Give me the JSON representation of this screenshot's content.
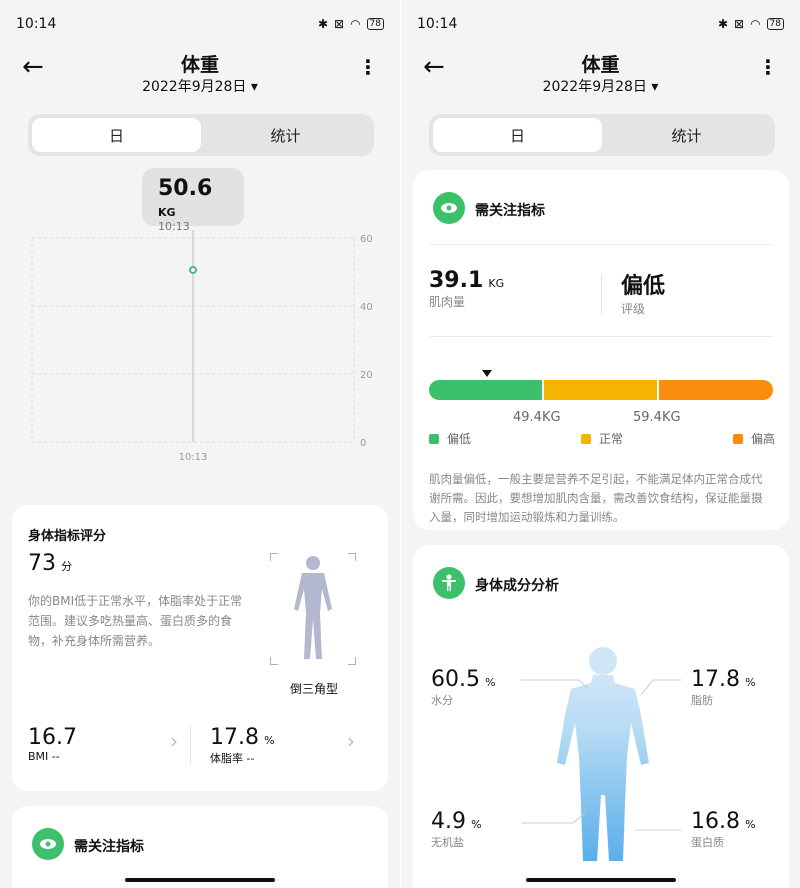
{
  "left": {
    "status": {
      "time": "10:14",
      "battery": "78"
    },
    "header": {
      "title": "体重",
      "date": "2022年9月28日",
      "date_caret": "▾"
    },
    "tabs": [
      "日",
      "统计"
    ],
    "tooltip": {
      "value": "50.6",
      "unit": "KG",
      "time": "10:13"
    },
    "chart_data": {
      "type": "scatter",
      "x": [
        "10:13"
      ],
      "y": [
        50.6
      ],
      "ylim": [
        0,
        60
      ],
      "yticks": [
        "60",
        "40",
        "20",
        "0"
      ],
      "xticks": [
        "10:13"
      ],
      "grid": true
    },
    "score_card": {
      "title": "身体指标评分",
      "score": "73",
      "score_unit": "分",
      "description": "你的BMI低于正常水平，体脂率处于正常范围。建议多吃热量高、蛋白质多的食物，补充身体所需营养。",
      "body_type": "倒三角型",
      "bmi": {
        "value": "16.7",
        "label": "BMI --"
      },
      "fat": {
        "value": "17.8",
        "unit": "%",
        "label": "体脂率 --"
      }
    },
    "attention_title": "需关注指标"
  },
  "right": {
    "status": {
      "time": "10:14",
      "battery": "78"
    },
    "header": {
      "title": "体重",
      "date": "2022年9月28日",
      "date_caret": "▾"
    },
    "tabs": [
      "日",
      "统计"
    ],
    "attention": {
      "title": "需关注指标",
      "muscle": {
        "value": "39.1",
        "unit": "KG",
        "label": "肌肉量"
      },
      "rating": {
        "value": "偏低",
        "label": "评级"
      },
      "thresholds": [
        "49.4KG",
        "59.4KG"
      ],
      "legend": [
        "偏低",
        "正常",
        "偏高"
      ],
      "colors": {
        "low": "#3dc06c",
        "normal": "#f5b400",
        "high": "#fb8c0c"
      },
      "marker_position": 0.17,
      "advice": "肌肉量偏低，一般主要是营养不足引起，不能满足体内正常合成代谢所需。因此，要想增加肌肉含量，需改善饮食结构，保证能量摄入量，同时增加运动锻炼和力量训练。"
    },
    "composition": {
      "title": "身体成分分析",
      "water": {
        "value": "60.5",
        "unit": "%",
        "label": "水分"
      },
      "fat": {
        "value": "17.8",
        "unit": "%",
        "label": "脂肪"
      },
      "mineral": {
        "value": "4.9",
        "unit": "%",
        "label": "无机盐"
      },
      "protein": {
        "value": "16.8",
        "unit": "%",
        "label": "蛋白质"
      }
    }
  }
}
